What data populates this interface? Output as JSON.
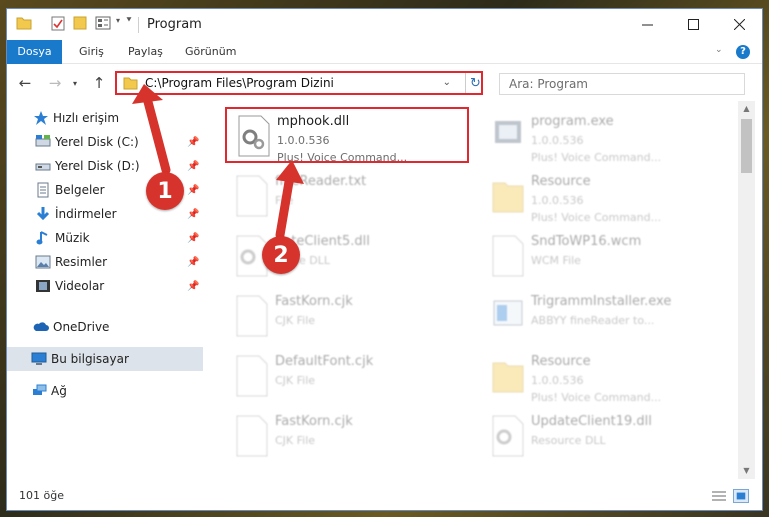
{
  "window": {
    "title": "Program"
  },
  "ribbon": {
    "tabs": [
      "Dosya",
      "Giriş",
      "Paylaş",
      "Görünüm"
    ]
  },
  "address": {
    "path": "C:\\Program Files\\Program Dizini"
  },
  "search": {
    "placeholder": "Ara: Program"
  },
  "sidebar": {
    "items": [
      {
        "label": "Hızlı erişim",
        "icon": "star-icon",
        "pinned": false
      },
      {
        "label": "Yerel Disk (C:)",
        "icon": "drive-icon",
        "pinned": true
      },
      {
        "label": "Yerel Disk (D:)",
        "icon": "drive-icon",
        "pinned": true
      },
      {
        "label": "Belgeler",
        "icon": "documents-icon",
        "pinned": true
      },
      {
        "label": "İndirmeler",
        "icon": "download-icon",
        "pinned": true
      },
      {
        "label": "Müzik",
        "icon": "music-icon",
        "pinned": true
      },
      {
        "label": "Resimler",
        "icon": "pictures-icon",
        "pinned": true
      },
      {
        "label": "Videolar",
        "icon": "video-icon",
        "pinned": true
      },
      {
        "label": "OneDrive",
        "icon": "cloud-icon",
        "pinned": false
      },
      {
        "label": "Bu bilgisayar",
        "icon": "computer-icon",
        "pinned": false
      },
      {
        "label": "Ağ",
        "icon": "network-icon",
        "pinned": false
      }
    ]
  },
  "files": [
    {
      "name": "mphook.dll",
      "line1": "1.0.0.536",
      "line2": "Plus! Voice Command...",
      "icon": "dll-gear-icon"
    },
    {
      "name": "program.exe",
      "line1": "1.0.0.536",
      "line2": "Plus! Voice Command...",
      "icon": "exe-icon"
    },
    {
      "name": "fineReader.txt",
      "line1": "File",
      "line2": "",
      "icon": "document-icon"
    },
    {
      "name": "Resource",
      "line1": "1.0.0.536",
      "line2": "Plus! Voice Command...",
      "icon": "folder-icon"
    },
    {
      "name": "dateClient5.dll",
      "line1": "ource DLL",
      "line2": "",
      "icon": "dll-gear-icon"
    },
    {
      "name": "SndToWP16.wcm",
      "line1": "WCM File",
      "line2": "",
      "icon": "document-icon"
    },
    {
      "name": "FastKorn.cjk",
      "line1": "CJK File",
      "line2": "",
      "icon": "document-icon"
    },
    {
      "name": "TrigrammInstaller.exe",
      "line1": "ABBYY fineReader to...",
      "line2": "",
      "icon": "installer-icon"
    },
    {
      "name": "DefaultFont.cjk",
      "line1": "CJK File",
      "line2": "",
      "icon": "document-icon"
    },
    {
      "name": "Resource",
      "line1": "1.0.0.536",
      "line2": "Plus! Voice Command...",
      "icon": "folder-icon"
    },
    {
      "name": "FastKorn.cjk",
      "line1": "CJK File",
      "line2": "",
      "icon": "document-icon"
    },
    {
      "name": "UpdateClient19.dll",
      "line1": "Resource DLL",
      "line2": "",
      "icon": "dll-gear-icon"
    }
  ],
  "status": {
    "count": "101 öğe"
  },
  "annotations": {
    "badge1": "1",
    "badge2": "2"
  },
  "colors": {
    "accent": "#1979ca",
    "highlight": "#e2282f",
    "badge": "#d6332c"
  }
}
